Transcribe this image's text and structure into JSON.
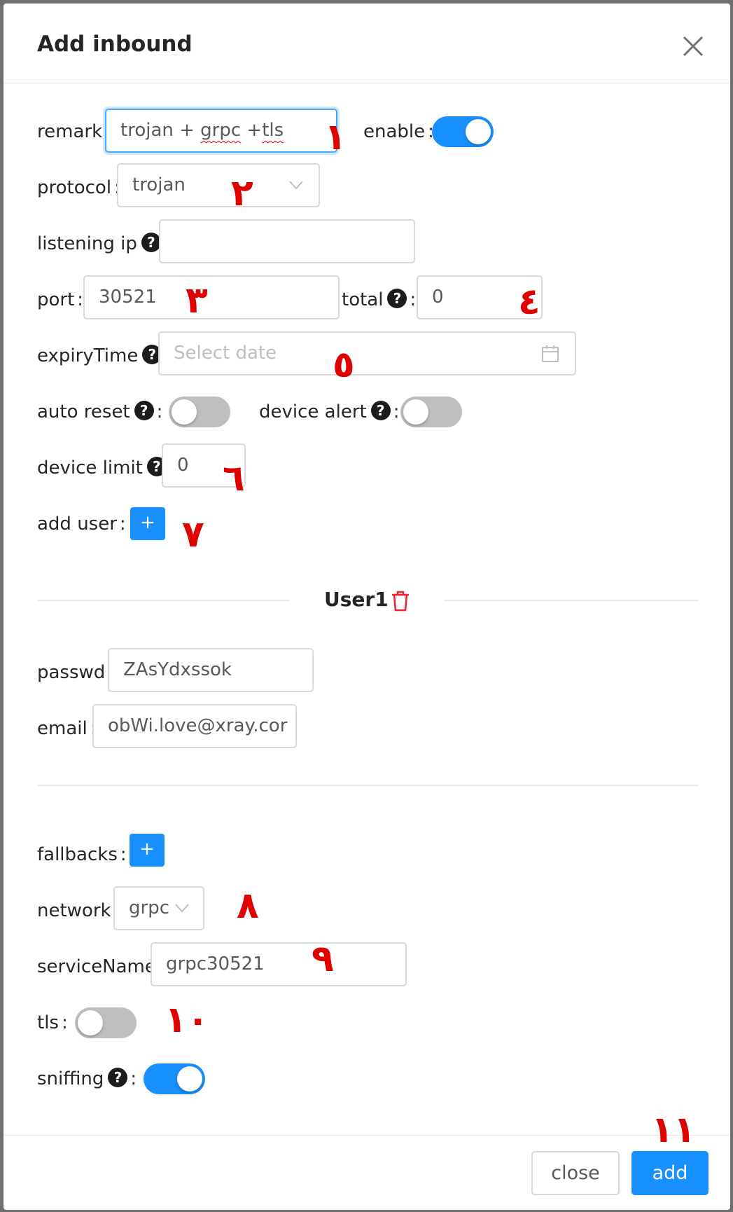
{
  "dialog": {
    "title": "Add inbound"
  },
  "form": {
    "remark": {
      "label": "remark",
      "value_part1": "trojan + ",
      "value_spell1": "grpc",
      "value_part2": " +",
      "value_spell2": "tls"
    },
    "enable": {
      "label": "enable",
      "on": true
    },
    "protocol": {
      "label": "protocol",
      "value": "trojan"
    },
    "listening_ip": {
      "label": "listening ip",
      "value": ""
    },
    "port": {
      "label": "port",
      "value": "30521"
    },
    "total": {
      "label": "total",
      "value": "0"
    },
    "expiry_time": {
      "label": "expiryTime",
      "placeholder": "Select date"
    },
    "auto_reset": {
      "label": "auto reset",
      "on": false
    },
    "device_alert": {
      "label": "device alert",
      "on": false
    },
    "device_limit": {
      "label": "device limit",
      "value": "0"
    },
    "add_user": {
      "label": "add user",
      "button": "+"
    }
  },
  "user_section": {
    "title": "User1",
    "passwd": {
      "label": "passwd",
      "value": "ZAsYdxssok"
    },
    "email": {
      "label": "email",
      "value": "obWi.love@xray.cor"
    }
  },
  "stream": {
    "fallbacks": {
      "label": "fallbacks",
      "button": "+"
    },
    "network": {
      "label": "network",
      "value": "grpc"
    },
    "service_name": {
      "label": "serviceName",
      "value": "grpc30521"
    },
    "tls": {
      "label": "tls",
      "on": false
    },
    "sniffing": {
      "label": "sniffing",
      "on": true
    }
  },
  "help_glyph": "?",
  "colon": ":",
  "footer": {
    "close_label": "close",
    "add_label": "add"
  },
  "annotations": [
    "١",
    "٢",
    "٣",
    "٤",
    "٥",
    "٦",
    "٧",
    "٨",
    "٩",
    "١٠",
    "١١"
  ],
  "colors": {
    "primary": "#1890ff",
    "annotation": "#e00000",
    "switch_off": "#bfbfbf",
    "danger_icon": "#f5222d"
  },
  "icons": {
    "close": "close-icon",
    "select_arrow": "chevron-down-icon",
    "calendar": "calendar-icon",
    "trash": "trash-icon",
    "help": "question-circle-icon"
  }
}
